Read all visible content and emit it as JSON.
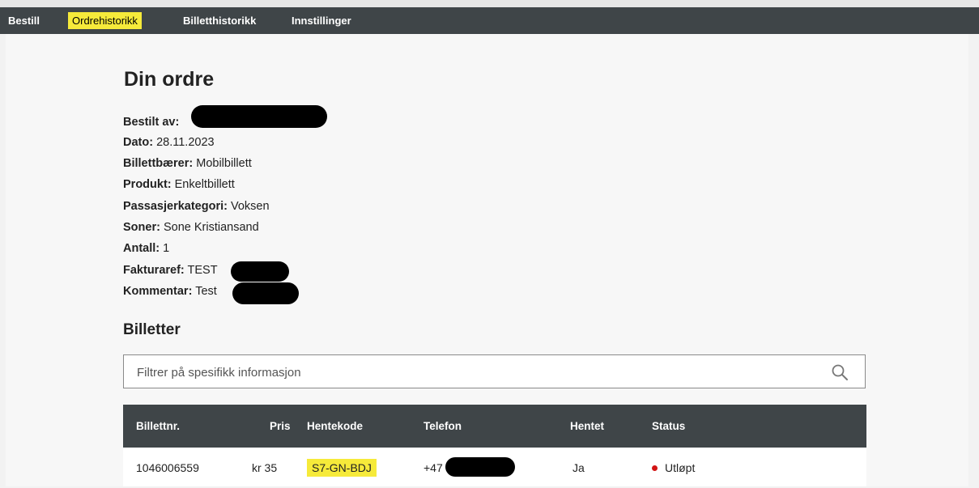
{
  "nav": {
    "items": [
      {
        "label": "Bestill"
      },
      {
        "label": "Ordrehistorikk"
      },
      {
        "label": "Billetthistorikk"
      },
      {
        "label": "Innstillinger"
      }
    ]
  },
  "order": {
    "title": "Din ordre",
    "fields": [
      {
        "label": "Bestilt av:",
        "value": ""
      },
      {
        "label": "Dato:",
        "value": "28.11.2023"
      },
      {
        "label": "Billettbærer:",
        "value": "Mobilbillett"
      },
      {
        "label": "Produkt:",
        "value": "Enkeltbillett"
      },
      {
        "label": "Passasjerkategori:",
        "value": "Voksen"
      },
      {
        "label": "Soner:",
        "value": "Sone Kristiansand"
      },
      {
        "label": "Antall:",
        "value": "1"
      },
      {
        "label": "Fakturaref:",
        "value": "TEST"
      },
      {
        "label": "Kommentar:",
        "value": "Test"
      }
    ]
  },
  "tickets": {
    "title": "Billetter",
    "search_placeholder": "Filtrer på spesifikk informasjon",
    "search_icon": "search-icon",
    "columns": [
      "Billettnr.",
      "Pris",
      "Hentekode",
      "Telefon",
      "Hentet",
      "Status"
    ],
    "rows": [
      {
        "billettnr": "1046006559",
        "pris": "kr 35",
        "hentekode": "S7-GN-BDJ",
        "telefon": "+47",
        "hentet": "Ja",
        "status": "Utløpt"
      }
    ]
  },
  "colors": {
    "navbar": "#3f4548",
    "highlight": "#f6ea3a",
    "status_expired": "#d21414"
  }
}
